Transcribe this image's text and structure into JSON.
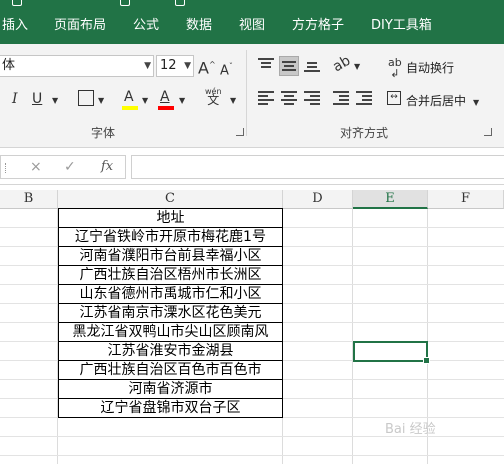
{
  "ribbon": {
    "tabs": [
      "插入",
      "页面布局",
      "公式",
      "数据",
      "视图",
      "方方格子",
      "DIY工具箱"
    ],
    "font": {
      "name_value": "体",
      "size_value": "12",
      "grow_label": "A",
      "shrink_label": "A",
      "italic": "I",
      "underline": "U",
      "fill_letter": "A",
      "font_color_letter": "A",
      "phonetic_label": "wén",
      "group_label": "字体",
      "fill_color": "#ffff00",
      "font_color": "#ff0000"
    },
    "align": {
      "wrap_label": "自动换行",
      "merge_label": "合并后居中",
      "group_label": "对齐方式"
    }
  },
  "formula_bar": {
    "cancel_icon": "×",
    "enter_icon": "✓",
    "fx_label": "fx"
  },
  "sheet": {
    "columns": [
      "B",
      "C",
      "D",
      "E",
      "F"
    ],
    "selected_column": "E",
    "table": {
      "header": "地址",
      "rows": [
        "辽宁省铁岭市开原市梅花鹿1号",
        "河南省濮阳市台前县幸福小区",
        "广西壮族自治区梧州市长洲区",
        "山东省德州市禹城市仁和小区",
        "江苏省南京市溧水区花色美元",
        "黑龙江省双鸭山市尖山区顾南风",
        "江苏省淮安市金湖县",
        "广西壮族自治区百色市百色市",
        "河南省济源市",
        "辽宁省盘锦市双台子区"
      ]
    }
  },
  "colors": {
    "accent": "#217346"
  },
  "watermark": "Bai 经验"
}
